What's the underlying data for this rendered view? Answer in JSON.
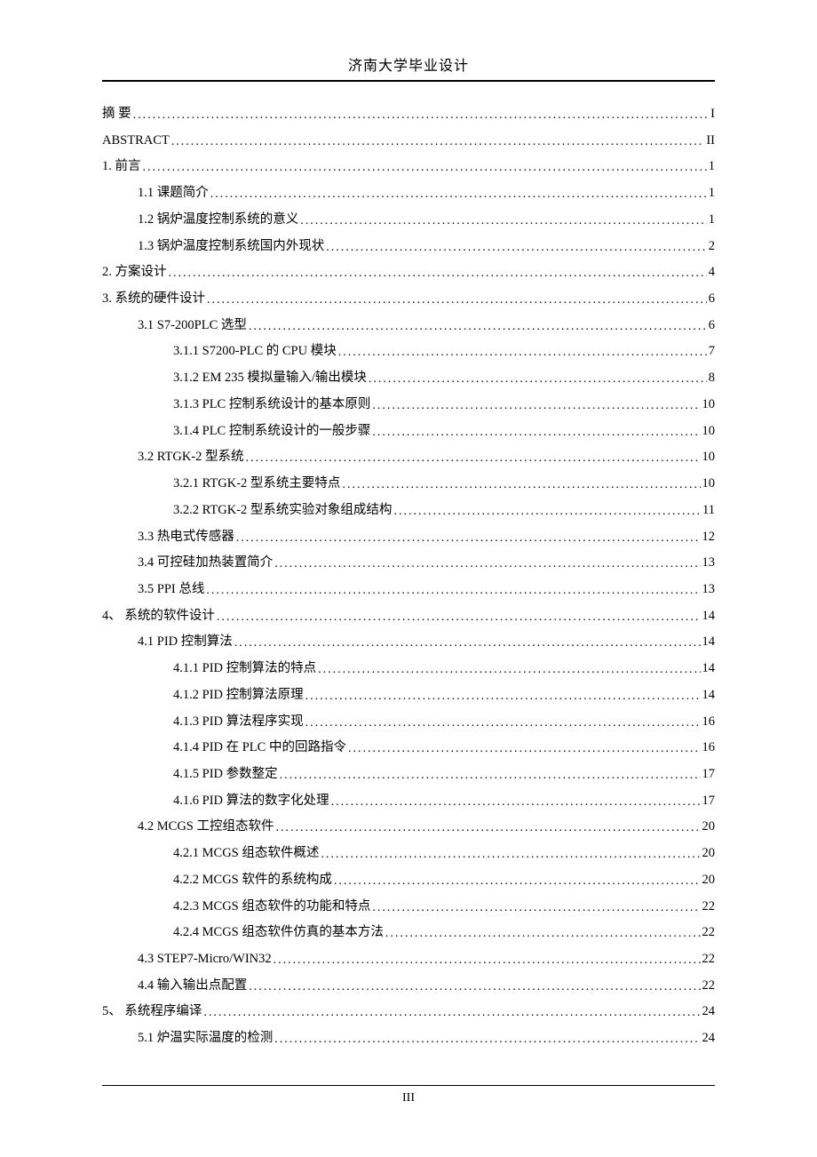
{
  "header": {
    "title": "济南大学毕业设计"
  },
  "toc": [
    {
      "label": "摘    要",
      "page": "I",
      "indent": 0
    },
    {
      "label": "ABSTRACT",
      "page": "II",
      "indent": 0
    },
    {
      "label": "1. 前言",
      "page": "1",
      "indent": 0
    },
    {
      "label": "1.1 课题简介",
      "page": "1",
      "indent": 1
    },
    {
      "label": "1.2 锅炉温度控制系统的意义",
      "page": "1",
      "indent": 1
    },
    {
      "label": "1.3  锅炉温度控制系统国内外现状",
      "page": "2",
      "indent": 1
    },
    {
      "label": "2. 方案设计",
      "page": "4",
      "indent": 0
    },
    {
      "label": "3. 系统的硬件设计",
      "page": "6",
      "indent": 0
    },
    {
      "label": "3.1 S7-200PLC 选型",
      "page": "6",
      "indent": 1
    },
    {
      "label": "3.1.1 S7200-PLC 的 CPU 模块",
      "page": "7",
      "indent": 2
    },
    {
      "label": "3.1.2  EM 235 模拟量输入/输出模块",
      "page": "8",
      "indent": 2
    },
    {
      "label": "3.1.3 PLC 控制系统设计的基本原则",
      "page": "10",
      "indent": 2
    },
    {
      "label": "3.1.4 PLC 控制系统设计的一般步骤",
      "page": "10",
      "indent": 2
    },
    {
      "label": "3.2 RTGK-2 型系统",
      "page": "10",
      "indent": 1
    },
    {
      "label": "3.2.1 RTGK-2 型系统主要特点",
      "page": "10",
      "indent": 2
    },
    {
      "label": "3.2.2 RTGK-2 型系统实验对象组成结构",
      "page": "11",
      "indent": 2
    },
    {
      "label": "3.3 热电式传感器",
      "page": "12",
      "indent": 1
    },
    {
      "label": "3.4 可控硅加热装置简介",
      "page": "13",
      "indent": 1
    },
    {
      "label": "3.5 PPI 总线",
      "page": "13",
      "indent": 1
    },
    {
      "label": "4、 系统的软件设计",
      "page": "14",
      "indent": 0
    },
    {
      "label": "4.1 PID 控制算法",
      "page": "14",
      "indent": 1
    },
    {
      "label": "4.1.1 PID 控制算法的特点",
      "page": "14",
      "indent": 2
    },
    {
      "label": "4.1.2 PID 控制算法原理",
      "page": "14",
      "indent": 2
    },
    {
      "label": "4.1.3 PID 算法程序实现",
      "page": "16",
      "indent": 2
    },
    {
      "label": "4.1.4 PID 在 PLC 中的回路指令",
      "page": "16",
      "indent": 2
    },
    {
      "label": "4.1.5 PID 参数整定",
      "page": "17",
      "indent": 2
    },
    {
      "label": "4.1.6 PID 算法的数字化处理",
      "page": "17",
      "indent": 2
    },
    {
      "label": "4.2 MCGS 工控组态软件",
      "page": "20",
      "indent": 1
    },
    {
      "label": "4.2.1 MCGS 组态软件概述",
      "page": "20",
      "indent": 2
    },
    {
      "label": "4.2.2 MCGS 软件的系统构成",
      "page": "20",
      "indent": 2
    },
    {
      "label": "4.2.3 MCGS 组态软件的功能和特点",
      "page": "22",
      "indent": 2
    },
    {
      "label": "4.2.4 MCGS 组态软件仿真的基本方法",
      "page": "22",
      "indent": 2
    },
    {
      "label": "4.3  STEP7-Micro/WIN32",
      "page": "22",
      "indent": 1
    },
    {
      "label": "4.4 输入输出点配置",
      "page": "22",
      "indent": 1
    },
    {
      "label": "5、 系统程序编译",
      "page": "24",
      "indent": 0
    },
    {
      "label": "5.1 炉温实际温度的检测",
      "page": "24",
      "indent": 1
    }
  ],
  "footer": {
    "page_number": "III"
  }
}
